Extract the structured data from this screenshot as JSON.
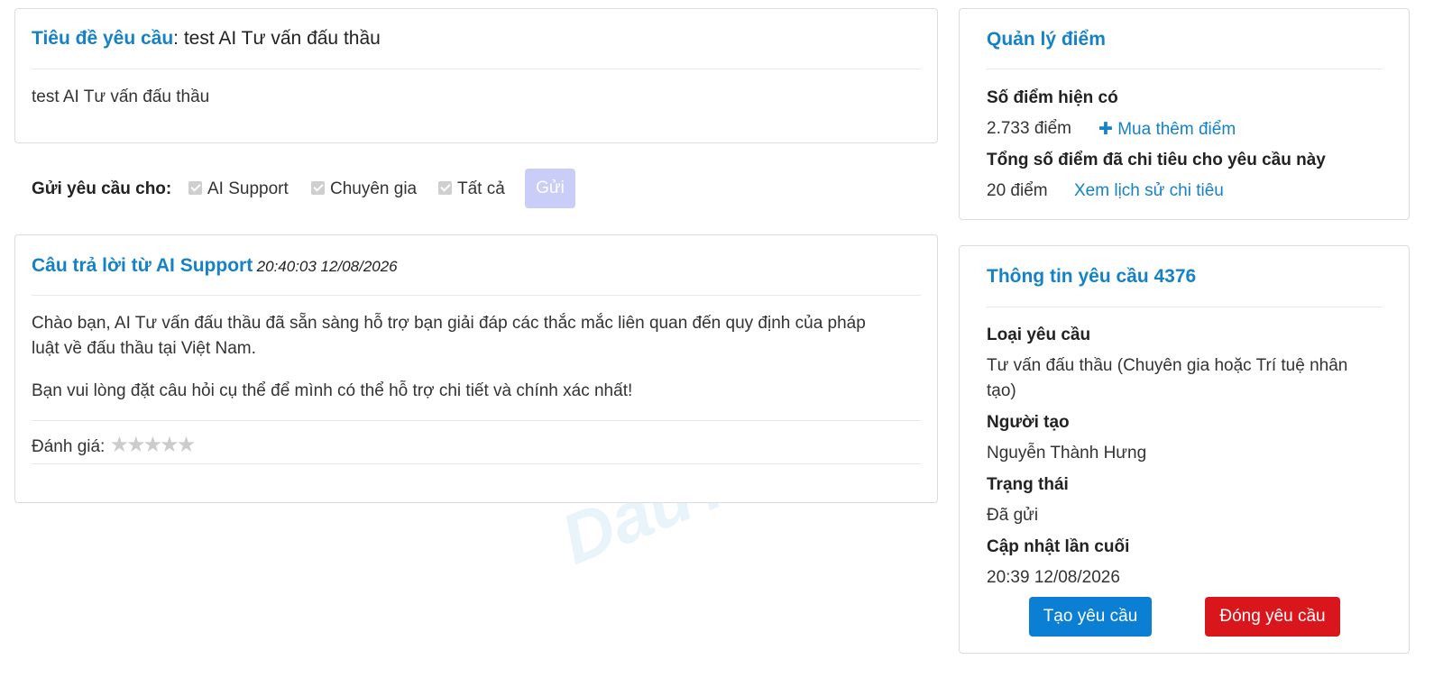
{
  "request": {
    "title_label": "Tiêu đề yêu cầu",
    "title_value": ": test AI Tư vấn đấu thầu",
    "body": "test AI Tư vấn đấu thầu"
  },
  "send": {
    "label": "Gửi yêu cầu cho:",
    "options": [
      "AI Support",
      "Chuyên gia",
      "Tất cả"
    ],
    "button": "Gửi"
  },
  "answer": {
    "heading": "Câu trả lời từ AI Support",
    "timestamp": "20:40:03 12/08/2026",
    "paragraph1_line1": "Chào bạn, AI Tư vấn đấu thầu đã sẵn sàng hỗ trợ bạn giải đáp các thắc mắc liên quan đến quy định của pháp",
    "paragraph1_line2": "luật về đấu thầu tại Việt Nam.",
    "paragraph2": "Bạn vui lòng đặt câu hỏi cụ thể để mình có thể hỗ trợ chi tiết và chính xác nhất!",
    "rating_label": "Đánh giá:",
    "rating_value": 0,
    "rating_max": 5
  },
  "points": {
    "heading": "Quản lý điểm",
    "current_label": "Số điểm hiện có",
    "current_value": "2.733 điểm",
    "buy_link": "Mua thêm điểm",
    "spent_label": "Tổng số điểm đã chi tiêu cho yêu cầu này",
    "spent_value": "20 điểm",
    "history_link": "Xem lịch sử chi tiêu"
  },
  "info": {
    "heading": "Thông tin yêu cầu 4376",
    "type_label": "Loại yêu cầu",
    "type_value_line1": "Tư vấn đấu thầu (Chuyên gia hoặc Trí tuệ nhân",
    "type_value_line2": "tạo)",
    "creator_label": "Người tạo",
    "creator_value": "Nguyễn Thành Hưng",
    "status_label": "Trạng thái",
    "status_value": "Đã gửi",
    "updated_label": "Cập nhật lần cuối",
    "updated_value": "20:39 12/08/2026",
    "create_button": "Tạo yêu cầu",
    "close_button": "Đóng yêu cầu"
  },
  "watermark": "DauThau"
}
